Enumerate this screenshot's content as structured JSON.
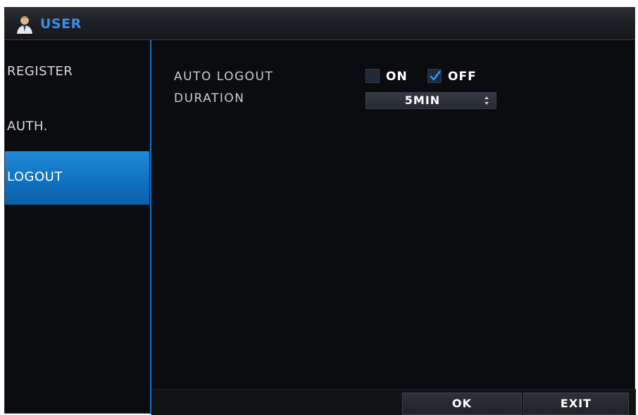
{
  "window": {
    "title": "USER",
    "icon": "user-icon"
  },
  "sidebar": {
    "items": [
      {
        "label": "REGISTER"
      },
      {
        "label": "AUTH."
      },
      {
        "label": "LOGOUT"
      }
    ],
    "active_index": 2
  },
  "settings": {
    "auto_logout": {
      "label": "AUTO LOGOUT",
      "on_label": "ON",
      "off_label": "OFF",
      "on_checked": false,
      "off_checked": true
    },
    "duration": {
      "label": "DURATION",
      "value": "5MIN"
    }
  },
  "buttons": {
    "ok": "OK",
    "exit": "EXIT"
  },
  "colors": {
    "accent_blue": "#1f8ad8",
    "title_text": "#3a8ee6",
    "background": "#0b0c10"
  }
}
